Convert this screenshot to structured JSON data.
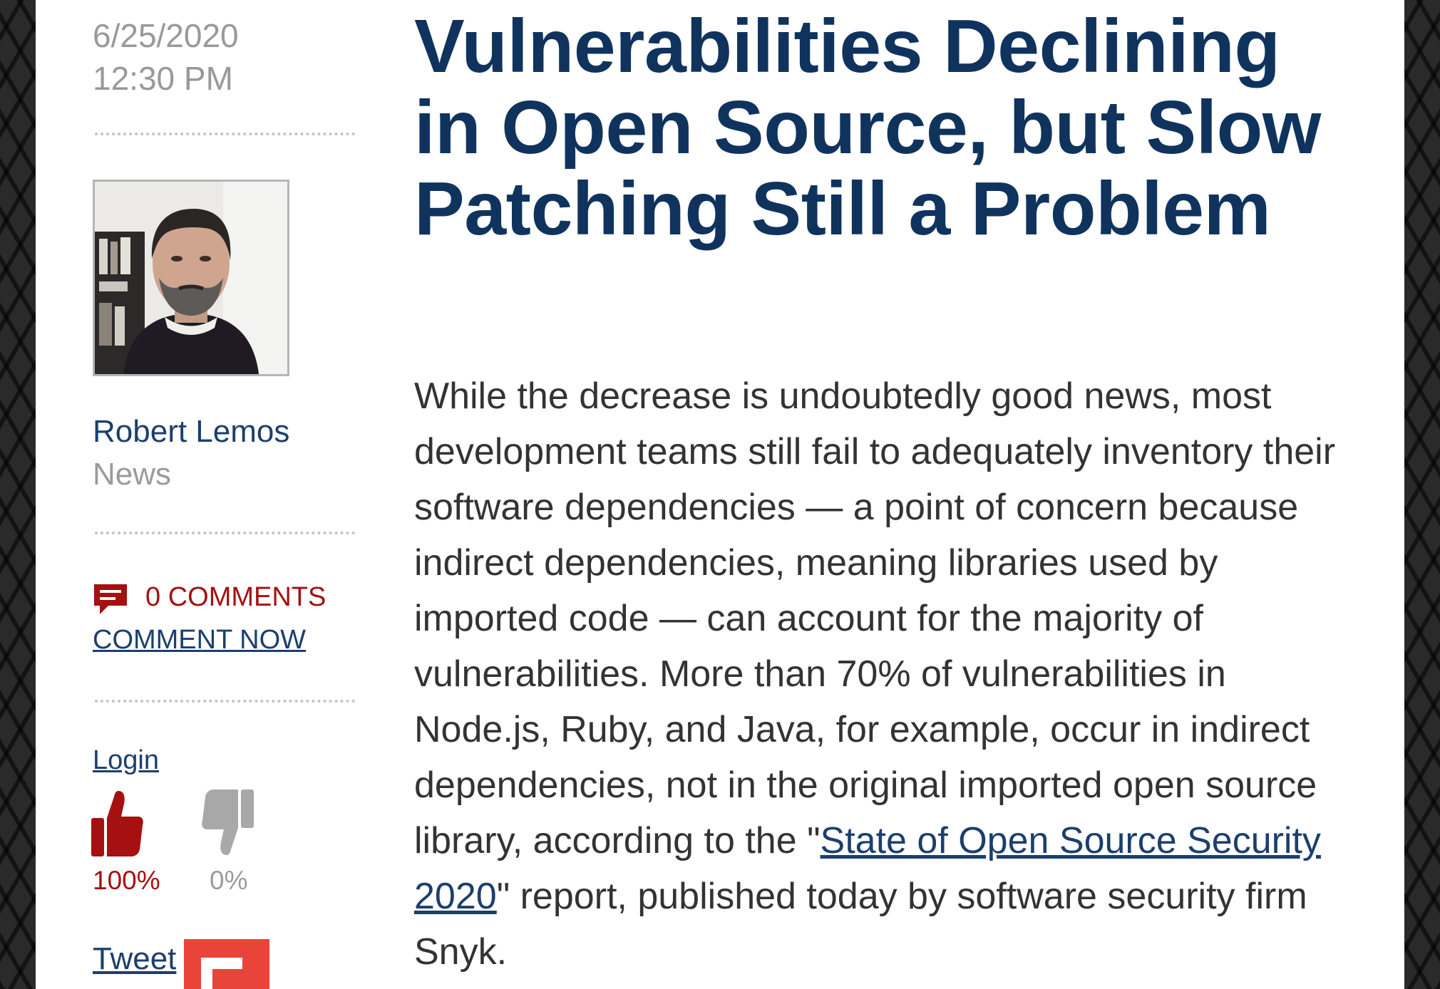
{
  "article": {
    "date": "6/25/2020",
    "time": "12:30 PM",
    "title": "Vulnerabilities Declining in Open Source, but Slow Patching Still a Problem",
    "body_before_link": "While the decrease is undoubtedly good news, most development teams still fail to adequately inventory their software dependencies — a point of concern because indirect dependencies, meaning libraries used by imported code — can account for the majority of vulnerabilities. More than 70% of vulnerabilities in Node.js, Ruby, and Java, for example, occur in indirect dependencies, not in the original imported open source library, according to the \"",
    "body_link_text": "State of Open Source Security 2020",
    "body_after_link": "\" report, published today by software security firm Snyk."
  },
  "author": {
    "name": "Robert Lemos",
    "role": "News"
  },
  "comments": {
    "count_label": "0 COMMENTS",
    "comment_now_label": "COMMENT NOW"
  },
  "rating": {
    "login_label": "Login",
    "thumbs_up_percent": "100%",
    "thumbs_down_percent": "0%"
  },
  "share": {
    "tweet_label": "Tweet"
  },
  "colors": {
    "headline": "#10335e",
    "link": "#1b3f6e",
    "accent_red": "#a51010",
    "muted_gray": "#9b9b9b",
    "share_red": "#e8443a"
  },
  "icons": [
    "comment-icon",
    "thumbs-up-icon",
    "thumbs-down-icon",
    "share-icon"
  ]
}
